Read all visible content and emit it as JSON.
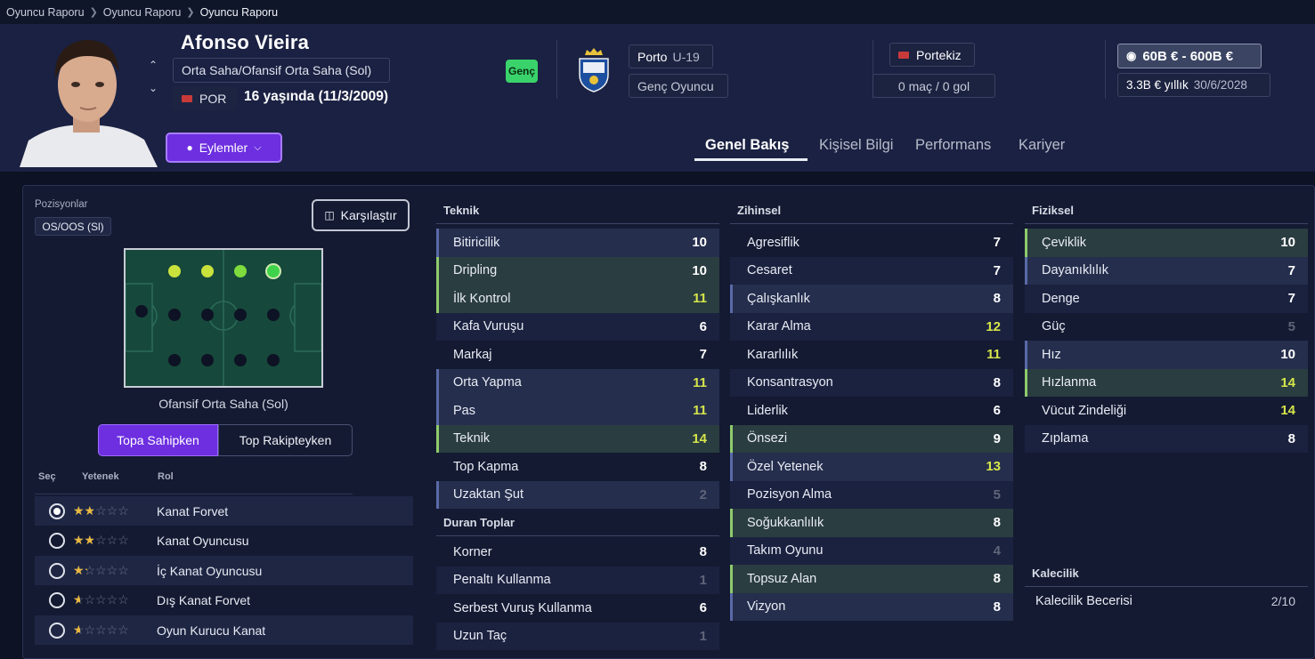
{
  "breadcrumb": [
    "Oyuncu Raporu",
    "Oyuncu Raporu",
    "Oyuncu Raporu"
  ],
  "player": {
    "name": "Afonso Vieira",
    "position": "Orta Saha/Ofansif Orta Saha (Sol)",
    "nation_code": "POR",
    "age_text": "16 yaşında (11/3/2009)",
    "badge": "Genç"
  },
  "club": {
    "name": "Porto",
    "squad": "U-19",
    "status": "Genç Oyuncu"
  },
  "nation": {
    "name": "Portekiz",
    "caps": "0 maç / 0 gol"
  },
  "contract": {
    "value": "60B € - 600B €",
    "wage": "3.3B € yıllık",
    "expiry": "30/6/2028"
  },
  "actions_label": "Eylemler",
  "tabs": [
    "Genel Bakış",
    "Kişisel Bilgi",
    "Performans",
    "Kariyer"
  ],
  "positions": {
    "label": "Pozisyonlar",
    "code": "OS/OOS (Sl)",
    "compare_label": "Karşılaştır",
    "caption": "Ofansif Orta Saha (Sol)",
    "seg_active": "Topa Sahipken",
    "seg_inactive": "Top Rakipteyken",
    "colors": {
      "pos_best": "#3fd34b",
      "pos_good": "#b9e23c",
      "pos_mid": "#d8e649"
    }
  },
  "roles": {
    "headers": [
      "Seç",
      "Yetenek",
      "Rol"
    ],
    "items": [
      {
        "name": "Kanat Forvet",
        "stars": 1.5,
        "selected": true
      },
      {
        "name": "Kanat Oyuncusu",
        "stars": 1.5,
        "selected": false
      },
      {
        "name": "İç Kanat Oyuncusu",
        "stars": 1,
        "selected": false
      },
      {
        "name": "Dış Kanat Forvet",
        "stars": 0.5,
        "selected": false
      },
      {
        "name": "Oyun Kurucu Kanat",
        "stars": 0.5,
        "selected": false
      }
    ]
  },
  "attributes": {
    "teknik": {
      "title": "Teknik",
      "items": [
        {
          "name": "Bitiricilik",
          "value": "10"
        },
        {
          "name": "Dripling",
          "value": "10"
        },
        {
          "name": "İlk Kontrol",
          "value": "11"
        },
        {
          "name": "Kafa Vuruşu",
          "value": "6"
        },
        {
          "name": "Markaj",
          "value": "7"
        },
        {
          "name": "Orta Yapma",
          "value": "11"
        },
        {
          "name": "Pas",
          "value": "11"
        },
        {
          "name": "Teknik",
          "value": "14"
        },
        {
          "name": "Top Kapma",
          "value": "8"
        },
        {
          "name": "Uzaktan Şut",
          "value": "2"
        }
      ]
    },
    "duran": {
      "title": "Duran Toplar",
      "items": [
        {
          "name": "Korner",
          "value": "8"
        },
        {
          "name": "Penaltı Kullanma",
          "value": "1"
        },
        {
          "name": "Serbest Vuruş Kullanma",
          "value": "6"
        },
        {
          "name": "Uzun Taç",
          "value": "1"
        }
      ]
    },
    "zihinsel": {
      "title": "Zihinsel",
      "items": [
        {
          "name": "Agresiflik",
          "value": "7"
        },
        {
          "name": "Cesaret",
          "value": "7"
        },
        {
          "name": "Çalışkanlık",
          "value": "8"
        },
        {
          "name": "Karar Alma",
          "value": "12"
        },
        {
          "name": "Kararlılık",
          "value": "11"
        },
        {
          "name": "Konsantrasyon",
          "value": "8"
        },
        {
          "name": "Liderlik",
          "value": "6"
        },
        {
          "name": "Önsezi",
          "value": "9"
        },
        {
          "name": "Özel Yetenek",
          "value": "13"
        },
        {
          "name": "Pozisyon Alma",
          "value": "5"
        },
        {
          "name": "Soğukkanlılık",
          "value": "8"
        },
        {
          "name": "Takım Oyunu",
          "value": "4"
        },
        {
          "name": "Topsuz Alan",
          "value": "8"
        },
        {
          "name": "Vizyon",
          "value": "8"
        }
      ]
    },
    "fiziksel": {
      "title": "Fiziksel",
      "items": [
        {
          "name": "Çeviklik",
          "value": "10"
        },
        {
          "name": "Dayanıklılık",
          "value": "7"
        },
        {
          "name": "Denge",
          "value": "7"
        },
        {
          "name": "Güç",
          "value": "5"
        },
        {
          "name": "Hız",
          "value": "10"
        },
        {
          "name": "Hızlanma",
          "value": "14"
        },
        {
          "name": "Vücut Zindeliği",
          "value": "14"
        },
        {
          "name": "Zıplama",
          "value": "8"
        }
      ]
    },
    "kalecilik": {
      "title": "Kalecilik",
      "skill_label": "Kalecilik Becerisi",
      "skill_value": "2/10"
    }
  }
}
